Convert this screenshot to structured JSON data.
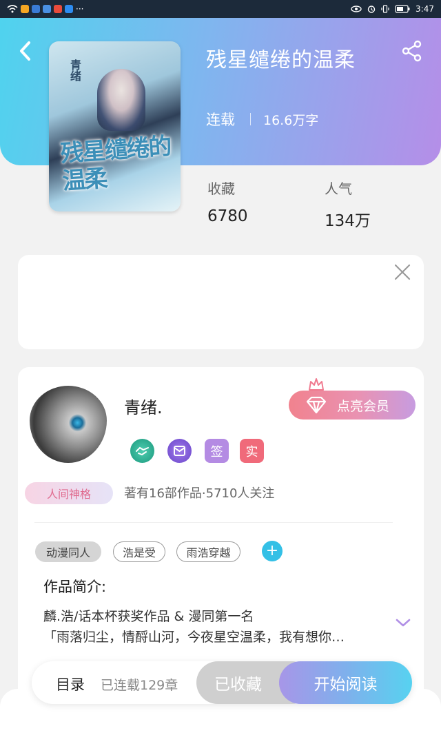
{
  "status_bar": {
    "time": "3:47",
    "more": "···"
  },
  "book": {
    "title": "残星缱绻的温柔",
    "status": "连载",
    "word_count": "16.6万字",
    "cover_series_text": "青绪",
    "cover_title": "残星缱绻的温柔"
  },
  "stats": {
    "favorites_label": "收藏",
    "favorites_value": "6780",
    "popularity_label": "人气",
    "popularity_value": "134万"
  },
  "author": {
    "name": "青绪.",
    "vip_label": "点亮会员",
    "badge_sign": "签",
    "badge_real": "实",
    "title_badge": "人间神格",
    "summary": "著有16部作品·5710人关注"
  },
  "tags": [
    "动漫同人",
    "浩是受",
    "雨浩穿越"
  ],
  "tag_add": "+",
  "intro": {
    "label": "作品简介:",
    "line1": "麟.浩/话本杯获奖作品 & 漫同第一名",
    "line2": "「雨落归尘，情酹山河，今夜星空温柔，我有想你…"
  },
  "bottom_bar": {
    "toc_label": "目录",
    "toc_count": "已连载129章",
    "favorited_label": "已收藏",
    "read_label": "开始阅读"
  },
  "colors": {
    "hero_start": "#4fd3ee",
    "hero_end": "#b58ee8",
    "vip_start": "#f1828e",
    "read_end": "#57d2f0"
  }
}
